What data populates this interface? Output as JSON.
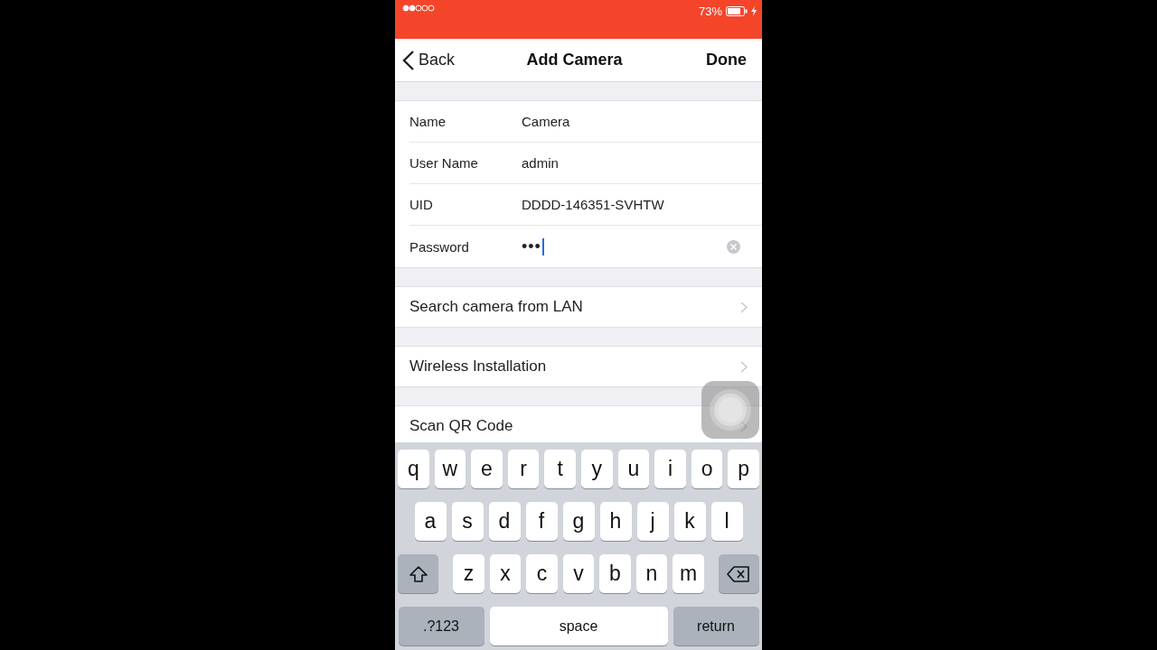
{
  "status_bar": {
    "battery": "73%"
  },
  "nav": {
    "back": "Back",
    "title": "Add Camera",
    "done": "Done"
  },
  "form": [
    {
      "label": "Name",
      "value": "Camera",
      "focused": false
    },
    {
      "label": "User Name",
      "value": "admin",
      "focused": false
    },
    {
      "label": "UID",
      "value": "DDDD-146351-SVHTW",
      "focused": false
    },
    {
      "label": "Password",
      "value": "•••",
      "focused": true
    }
  ],
  "actions": [
    {
      "label": "Search camera from LAN"
    },
    {
      "label": "Wireless Installation"
    },
    {
      "label": "Scan QR Code"
    }
  ],
  "keyboard": {
    "rows": [
      {
        "keys": [
          {
            "kind": "letter",
            "label": "q"
          },
          {
            "kind": "letter",
            "label": "w"
          },
          {
            "kind": "letter",
            "label": "e"
          },
          {
            "kind": "letter",
            "label": "r"
          },
          {
            "kind": "letter",
            "label": "t"
          },
          {
            "kind": "letter",
            "label": "y"
          },
          {
            "kind": "letter",
            "label": "u"
          },
          {
            "kind": "letter",
            "label": "i"
          },
          {
            "kind": "letter",
            "label": "o"
          },
          {
            "kind": "letter",
            "label": "p"
          }
        ]
      },
      {
        "keys": [
          {
            "kind": "letter",
            "label": "a"
          },
          {
            "kind": "letter",
            "label": "s"
          },
          {
            "kind": "letter",
            "label": "d"
          },
          {
            "kind": "letter",
            "label": "f"
          },
          {
            "kind": "letter",
            "label": "g"
          },
          {
            "kind": "letter",
            "label": "h"
          },
          {
            "kind": "letter",
            "label": "j"
          },
          {
            "kind": "letter",
            "label": "k"
          },
          {
            "kind": "letter",
            "label": "l"
          }
        ]
      },
      {
        "keys": [
          {
            "kind": "shift"
          },
          {
            "kind": "letter",
            "label": "z"
          },
          {
            "kind": "letter",
            "label": "x"
          },
          {
            "kind": "letter",
            "label": "c"
          },
          {
            "kind": "letter",
            "label": "v"
          },
          {
            "kind": "letter",
            "label": "b"
          },
          {
            "kind": "letter",
            "label": "n"
          },
          {
            "kind": "letter",
            "label": "m"
          },
          {
            "kind": "delete"
          }
        ]
      },
      {
        "keys": [
          {
            "kind": "mode",
            "label": ".?123"
          },
          {
            "kind": "space",
            "label": "space"
          },
          {
            "kind": "return",
            "label": "return"
          }
        ]
      }
    ]
  }
}
